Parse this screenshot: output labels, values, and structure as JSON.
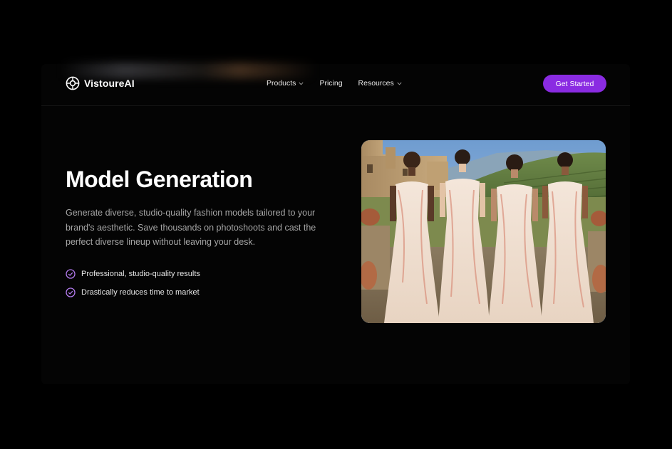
{
  "brand": {
    "name": "VistoureAI",
    "logo_icon": "aperture-icon"
  },
  "nav": {
    "items": [
      {
        "label": "Products",
        "has_dropdown": true
      },
      {
        "label": "Pricing",
        "has_dropdown": false
      },
      {
        "label": "Resources",
        "has_dropdown": true
      }
    ],
    "cta_label": "Get Started"
  },
  "hero": {
    "title": "Model Generation",
    "description": "Generate diverse, studio-quality fashion models tailored to your brand's aesthetic. Save thousands on photoshoots and cast the perfect diverse lineup without leaving your desk.",
    "features": [
      {
        "label": "Professional, studio-quality results",
        "icon": "check-circle-icon"
      },
      {
        "label": "Drastically reduces time to market",
        "icon": "check-circle-icon"
      }
    ],
    "image_alt": "Four models in embroidered ivory gowns on a Tuscan terrace"
  },
  "colors": {
    "accent": "#8a2be2",
    "check": "#b57cf0",
    "background": "#000000",
    "text_muted": "#a6a6a6"
  }
}
